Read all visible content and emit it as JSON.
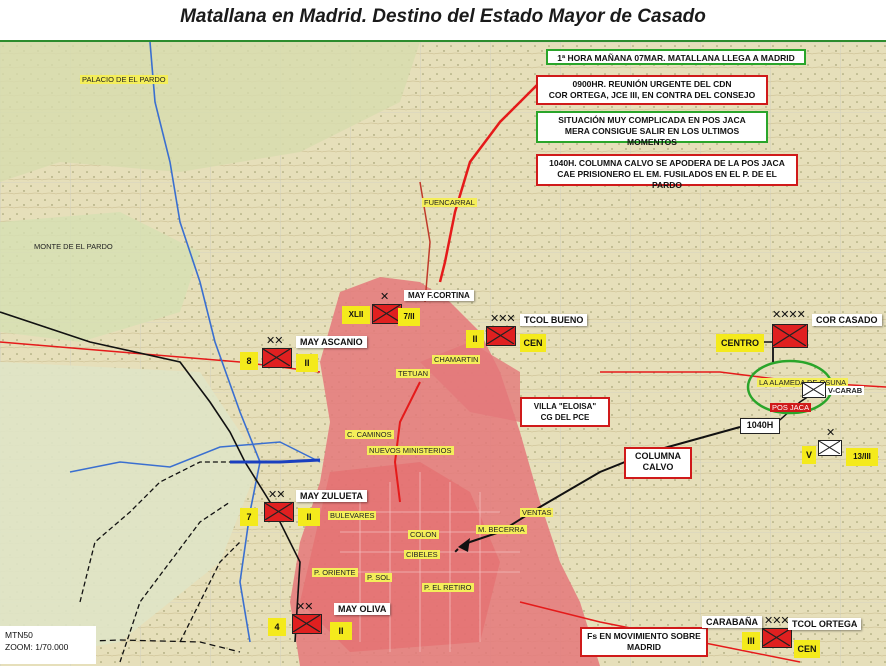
{
  "title": "Matallana en Madrid. Destino del Estado Mayor de Casado",
  "annotations": {
    "note1": "1ª HORA MAÑANA 07MAR.  MATALLANA LLEGA A MADRID",
    "note2_line1": "0900HR.  REUNIÓN URGENTE DEL CDN",
    "note2_line2": "COR ORTEGA, JCE III,  EN CONTRA DEL CONSEJO",
    "note3_line1": "SITUACIÓN  MUY COMPLICADA EN POS JACA",
    "note3_line2": "MERA CONSIGUE SALIR EN LOS ULTIMOS MOMENTOS",
    "note4_line1": "1040H. COLUMNA CALVO SE APODERA DE LA POS JACA",
    "note4_line2": "CAE PRISIONERO EL EM. FUSILADOS EN EL P. DE EL PARDO",
    "villa_line1": "VILLA \"ELOISA\"",
    "villa_line2": "CG DEL  PCE",
    "columna_line1": "COLUMNA",
    "columna_line2": "CALVO",
    "time_1040": "1040H",
    "fs_line1": "Fs EN MOVIMIENTO SOBRE",
    "fs_line2": "MADRID"
  },
  "units": {
    "ascanio": {
      "label": "MAY ASCANIO",
      "number": "8",
      "echelon": "II"
    },
    "cortina": {
      "label": "MAY F.CORTINA",
      "number": "XLII",
      "echelon": "7/II"
    },
    "bueno": {
      "label": "TCOL BUENO",
      "number": "II",
      "tag": "CEN"
    },
    "casado": {
      "label": "COR CASADO",
      "tag": "CENTRO"
    },
    "zulueta": {
      "label": "MAY ZULUETA",
      "number": "7",
      "echelon": "II"
    },
    "oliva": {
      "label": "MAY OLIVA",
      "number": "4",
      "echelon": "II"
    },
    "ortega": {
      "label": "TCOL ORTEGA",
      "number": "III",
      "tag": "CEN",
      "place": "CARABAÑA"
    },
    "vcarab": {
      "label": "V-CARAB"
    },
    "v13": {
      "number": "V",
      "echelon": "13/III"
    }
  },
  "places": {
    "pardo_palace": "PALACIO DE EL PARDO",
    "monte_pardo": "MONTE DE EL PARDO",
    "fuencarral": "FUENCARRAL",
    "chamartin": "CHAMARTIN",
    "tetuan": "TETUAN",
    "caminos": "C. CAMINOS",
    "nuevos_ministerios": "NUEVOS MINISTERIOS",
    "bulevares": "BULEVARES",
    "colon": "COLON",
    "ventas": "VENTAS",
    "becerra": "M. BECERRA",
    "cibeles": "CIBELES",
    "oriente": "P. ORIENTE",
    "sol": "P. SOL",
    "retiro": "P. EL RETIRO",
    "alameda": "LA ALAMEDA DE OSUNA",
    "pos_jaca": "POS JACA"
  },
  "map_info": {
    "sheet": "MTN50",
    "zoom": "ZOOM: 1/70.000"
  },
  "colors": {
    "urban": "#e4787a",
    "unit_fill": "#e02020",
    "frame_green": "#2aa52a",
    "frame_red": "#d01a1a",
    "label_yellow": "#f4ea1c"
  }
}
